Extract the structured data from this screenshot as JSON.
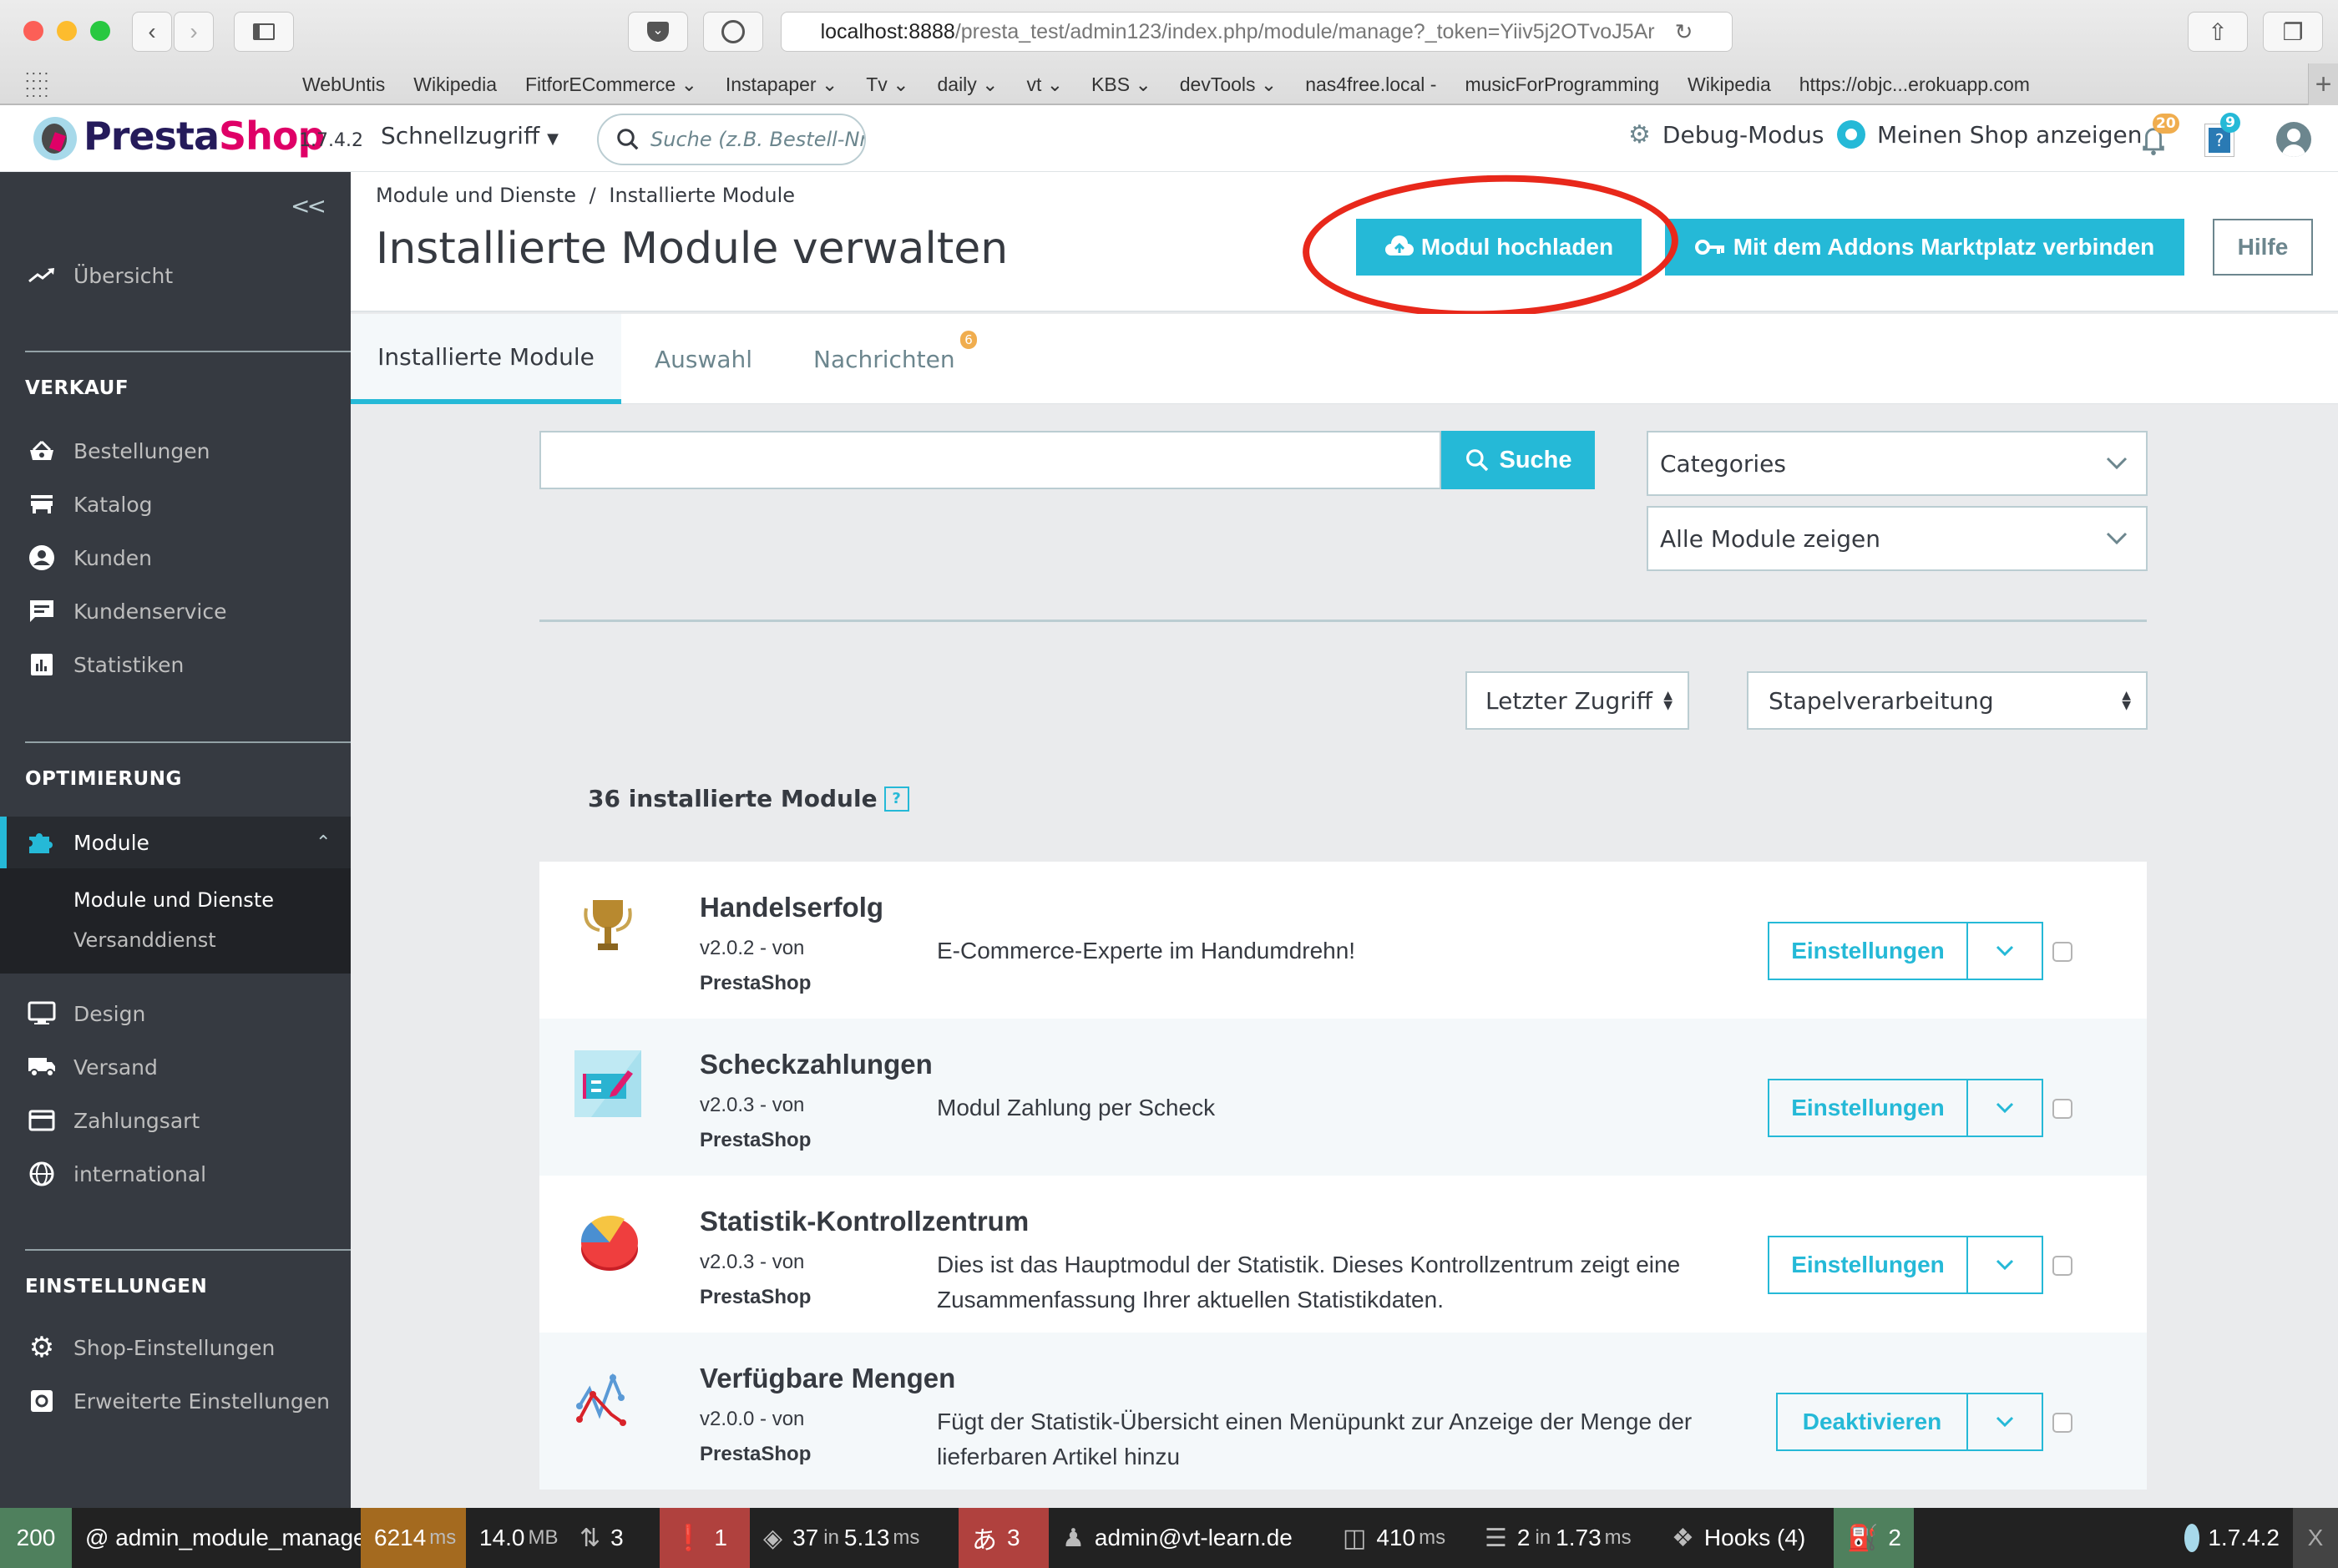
{
  "browser": {
    "url_host": "localhost:8888",
    "url_path": "/presta_test/admin123/index.php/module/manage?_token=Yiiv5j2OTvoJ5Ar",
    "bookmarks": [
      {
        "label": "WebUntis",
        "dropdown": false
      },
      {
        "label": "Wikipedia",
        "dropdown": false
      },
      {
        "label": "FitforECommerce",
        "dropdown": true
      },
      {
        "label": "Instapaper",
        "dropdown": true
      },
      {
        "label": "Tv",
        "dropdown": true
      },
      {
        "label": "daily",
        "dropdown": true
      },
      {
        "label": "vt",
        "dropdown": true
      },
      {
        "label": "KBS",
        "dropdown": true
      },
      {
        "label": "devTools",
        "dropdown": true
      },
      {
        "label": "nas4free.local -",
        "dropdown": false
      },
      {
        "label": "musicForProgramming",
        "dropdown": false
      },
      {
        "label": "Wikipedia",
        "dropdown": false
      },
      {
        "label": "https://objc...erokuapp.com",
        "dropdown": false
      }
    ]
  },
  "header": {
    "logo_part1": "Presta",
    "logo_part2": "Shop",
    "version": "1.7.4.2",
    "quick_access": "Schnellzugriff",
    "search_placeholder": "Suche (z.B. Bestell-Nr., Kundenname...)",
    "debug_mode": "Debug-Modus",
    "view_shop": "Meinen Shop anzeigen",
    "notifications_count": "20",
    "help_count": "9"
  },
  "sidebar": {
    "collapse": "<<",
    "overview": "Übersicht",
    "sections": [
      {
        "title": "VERKAUF",
        "items": [
          "Bestellungen",
          "Katalog",
          "Kunden",
          "Kundenservice",
          "Statistiken"
        ]
      },
      {
        "title": "OPTIMIERUNG",
        "items": [
          "Module",
          "Design",
          "Versand",
          "Zahlungsart",
          "international"
        ]
      },
      {
        "title": "EINSTELLUNGEN",
        "items": [
          "Shop-Einstellungen",
          "Erweiterte Einstellungen"
        ]
      }
    ],
    "module_submenu": [
      "Module und Dienste",
      "Versanddienst"
    ]
  },
  "page": {
    "breadcrumb": [
      "Module und Dienste",
      "Installierte Module"
    ],
    "breadcrumb_sep": "/",
    "title": "Installierte Module verwalten",
    "upload_button": "Modul hochladen",
    "addons_button": "Mit dem Addons Marktplatz verbinden",
    "help_button": "Hilfe",
    "tabs": [
      {
        "label": "Installierte Module",
        "active": true
      },
      {
        "label": "Auswahl",
        "active": false
      },
      {
        "label": "Nachrichten",
        "active": false,
        "badge": "6"
      }
    ]
  },
  "filters": {
    "search_value": "",
    "search_button": "Suche",
    "categories": "Categories",
    "status": "Alle Module zeigen",
    "sort": "Letzter Zugriff",
    "bulk": "Stapelverarbeitung"
  },
  "modules_count_label": "36 installierte Module",
  "modules_help": "?",
  "modules": [
    {
      "name": "Handelserfolg",
      "version": "v2.0.2 - von",
      "author": "PrestaShop",
      "description": "E-Commerce-Experte im Handumdrehn!",
      "action": "Einstellungen",
      "icon": "trophy-icon"
    },
    {
      "name": "Scheckzahlungen",
      "version": "v2.0.3 - von",
      "author": "PrestaShop",
      "description": "Modul Zahlung per Scheck",
      "action": "Einstellungen",
      "icon": "cheque-icon"
    },
    {
      "name": "Statistik-Kontrollzentrum",
      "version": "v2.0.3 - von",
      "author": "PrestaShop",
      "description": "Dies ist das Hauptmodul der Statistik. Dieses Kontrollzentrum zeigt eine Zusammenfassung Ihrer aktuellen Statistikdaten.",
      "action": "Einstellungen",
      "icon": "pie-chart-icon"
    },
    {
      "name": "Verfügbare Mengen",
      "version": "v2.0.0 - von",
      "author": "PrestaShop",
      "description": "Fügt der Statistik-Übersicht einen Menüpunkt zur Anzeige der Menge der lieferbaren Artikel hinzu",
      "action": "Deaktivieren",
      "icon": "line-chart-icon"
    }
  ],
  "debugbar": {
    "status": "200",
    "route": "@ admin_module_manage",
    "time": "6214",
    "time_unit": "ms",
    "memory": "14.0",
    "memory_unit": "MB",
    "redirects": "3",
    "errors": "1",
    "queries": "37",
    "queries_in": "in",
    "queries_time": "5.13",
    "queries_unit": "ms",
    "translations": "3",
    "user": "admin@vt-learn.de",
    "render_time": "410",
    "render_unit": "ms",
    "cache": "2",
    "cache_in": "in",
    "cache_time": "1.73",
    "cache_unit": "ms",
    "hooks": "Hooks (4)",
    "doctrine": "2",
    "ps_version": "1.7.4.2",
    "close": "X"
  },
  "colors": {
    "accent": "#25b9d7",
    "sidebar_bg": "#363a41",
    "highlight_ring": "#e8281b",
    "badge_orange": "#f0ad4e"
  }
}
